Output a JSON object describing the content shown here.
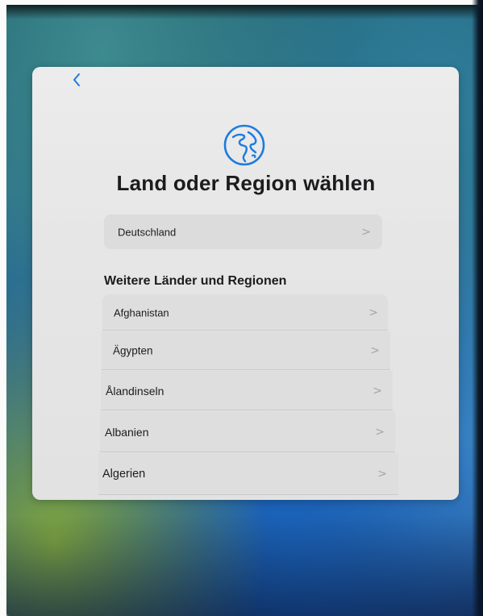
{
  "screen": {
    "title": "Land oder Region wählen",
    "back_icon": "chevron-left-icon",
    "header_icon": "globe-icon"
  },
  "current_region": {
    "label": "Deutschland",
    "chevron": ">"
  },
  "more_regions": {
    "header": "Weitere Länder und Regionen",
    "items": [
      {
        "label": "Afghanistan",
        "chevron": ">"
      },
      {
        "label": "Ägypten",
        "chevron": ">"
      },
      {
        "label": "Ålandinseln",
        "chevron": ">"
      },
      {
        "label": "Albanien",
        "chevron": ">"
      },
      {
        "label": "Algerien",
        "chevron": ">"
      }
    ]
  },
  "colors": {
    "accent": "#1c7be0",
    "sheet_background": "#e8e8e8",
    "row_background": "#dedede",
    "text": "#1c1c1e",
    "chevron": "#a5a5a8"
  }
}
